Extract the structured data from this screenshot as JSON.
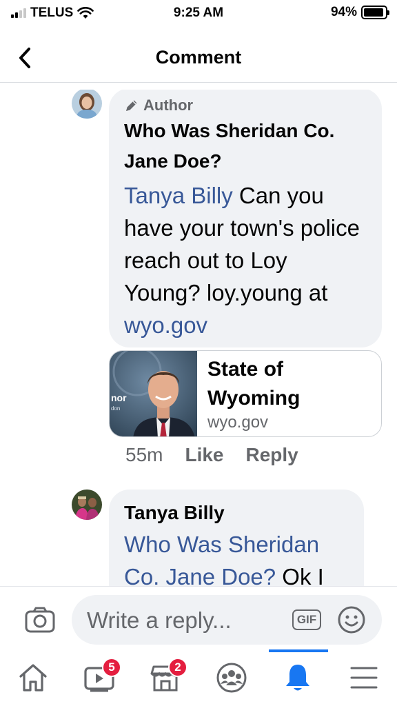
{
  "status_bar": {
    "carrier": "TELUS",
    "time": "9:25 AM",
    "battery_percent": "94%",
    "battery_level": 0.94
  },
  "header": {
    "title": "Comment",
    "back_icon": "chevron-left-icon"
  },
  "comments": [
    {
      "author_tag": "Author",
      "name": "Who Was Sheridan Co. Jane Doe?",
      "mention": "Tanya Billy",
      "text": " Can you have your town's police reach out to Loy Young? loy.young at ",
      "link_text": "wyo.gov",
      "link_preview": {
        "title": "State of Wyoming",
        "domain": "wyo.gov"
      },
      "actions": {
        "time": "55m",
        "like": "Like",
        "reply": "Reply"
      }
    },
    {
      "name": "Tanya Billy",
      "mention": "Who Was Sheridan Co. Jane Doe?",
      "text": " Ok I"
    }
  ],
  "reply_bar": {
    "placeholder": "Write a reply...",
    "gif_label": "GIF"
  },
  "bottom_nav": {
    "items": [
      {
        "icon": "home-icon",
        "badge": ""
      },
      {
        "icon": "video-icon",
        "badge": "5"
      },
      {
        "icon": "marketplace-icon",
        "badge": "2"
      },
      {
        "icon": "groups-icon",
        "badge": ""
      },
      {
        "icon": "bell-icon",
        "badge": ""
      },
      {
        "icon": "menu-icon",
        "badge": ""
      }
    ],
    "active_index": 4
  },
  "colors": {
    "accent": "#1877f2",
    "link": "#385898",
    "badge": "#e41e3f",
    "bubble": "#f0f2f5",
    "muted": "#65676b"
  }
}
